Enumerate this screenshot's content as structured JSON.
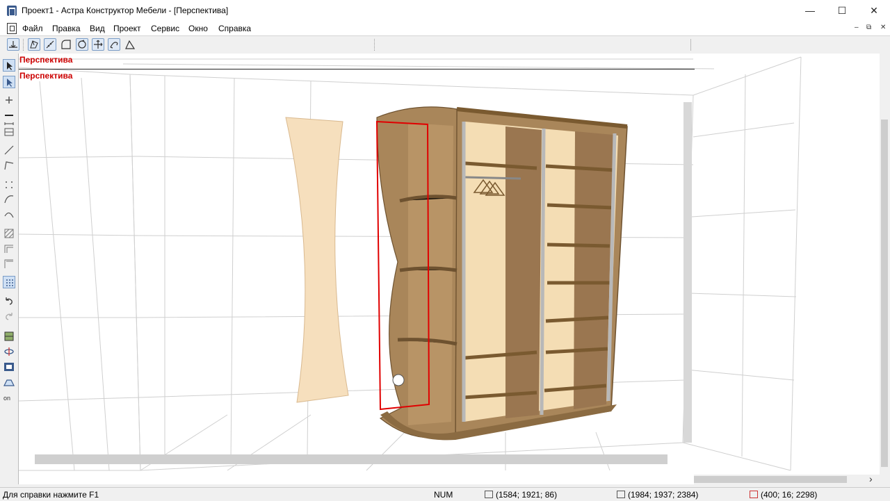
{
  "window": {
    "title": "Проект1 - Астра Конструктор Мебели - [Перспектива]",
    "minimize_glyph": "—",
    "maximize_glyph": "☐",
    "close_glyph": "✕"
  },
  "menu": {
    "items": [
      "Файл",
      "Правка",
      "Вид",
      "Проект",
      "Сервис",
      "Окно",
      "Справка"
    ],
    "mdi_min": "–",
    "mdi_restore": "⧉",
    "mdi_close": "✕"
  },
  "toolbar": {
    "icons": [
      "snap-icon",
      "edit-panel-icon",
      "ruler-icon",
      "contour-icon",
      "rotate-icon",
      "move-icon",
      "mirror-icon",
      "angle-icon"
    ]
  },
  "viewport": {
    "label_top": "Перспектива",
    "label_inner": "Перспектива",
    "scrollbar_arrow": "›"
  },
  "status": {
    "help": "Для справки нажмите F1",
    "num": "NUM",
    "coord1": "(1584; 1921; 86)",
    "coord2": "(1984; 1937; 2384)",
    "coord3": "(400; 16; 2298)"
  },
  "colors": {
    "wood": "#a9865a",
    "wood_dark": "#8b6b42",
    "facade": "#f6dfbd",
    "selection": "#e00000",
    "label": "#cc0000",
    "accent": "#7a9cc6"
  }
}
